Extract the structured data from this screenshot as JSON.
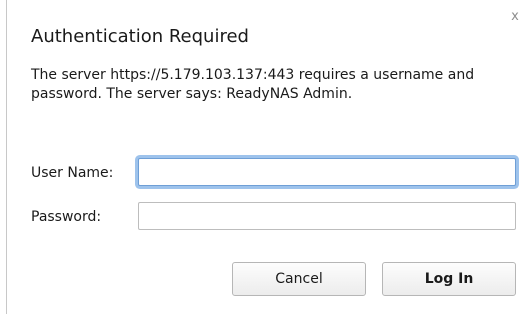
{
  "dialog": {
    "title": "Authentication Required",
    "message": "The server https://5.179.103.137:443 requires a username and password. The server says: ReadyNAS Admin.",
    "close_glyph": "x"
  },
  "form": {
    "username_label": "User Name:",
    "username_value": "",
    "password_label": "Password:",
    "password_value": ""
  },
  "buttons": {
    "cancel_label": "Cancel",
    "login_label": "Log In"
  },
  "colors": {
    "focus_ring": "#9ec3ec",
    "focus_border": "#6f9fd6"
  }
}
